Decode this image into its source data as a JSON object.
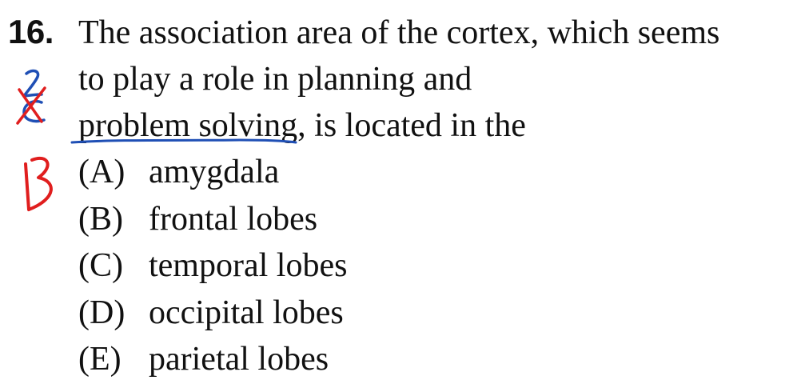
{
  "question": {
    "number": "16.",
    "stem_lines": [
      "The association area of the cortex, which seems",
      "to play a role in planning and",
      "problem solving, is located in the"
    ]
  },
  "choices": [
    {
      "letter": "(A)",
      "text": "amygdala"
    },
    {
      "letter": "(B)",
      "text": "frontal lobes"
    },
    {
      "letter": "(C)",
      "text": "temporal lobes"
    },
    {
      "letter": "(D)",
      "text": "occipital lobes"
    },
    {
      "letter": "(E)",
      "text": "parietal lobes"
    }
  ],
  "annotations": {
    "blue_ink": "#1f4fb5",
    "red_ink": "#e01e1e",
    "handwritten_answer": "B",
    "handwritten_mark": "2 crossed-out"
  }
}
